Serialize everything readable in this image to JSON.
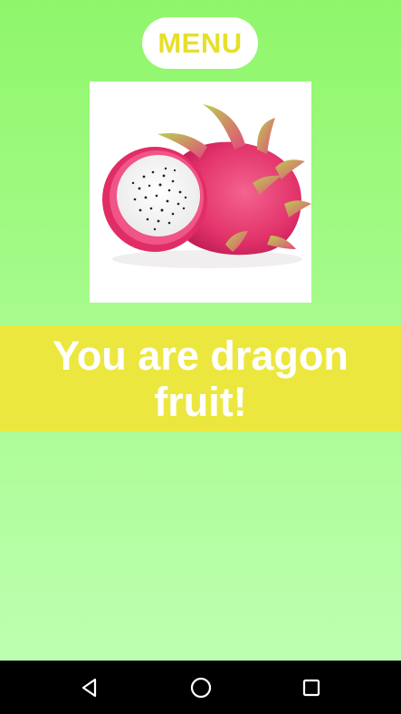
{
  "header": {
    "menu_label": "MENU"
  },
  "result": {
    "text": "You are dragon fruit!",
    "image_alt": "dragon-fruit-image"
  },
  "colors": {
    "background_top": "#8ff66a",
    "background_bottom": "#bdffb0",
    "menu_text": "#e6df2c",
    "result_band": "#ece73e",
    "fruit_skin": "#e8386f",
    "navbar": "#000000"
  },
  "navbar": {
    "back_icon": "back-triangle-icon",
    "home_icon": "home-circle-icon",
    "recents_icon": "recents-square-icon"
  }
}
